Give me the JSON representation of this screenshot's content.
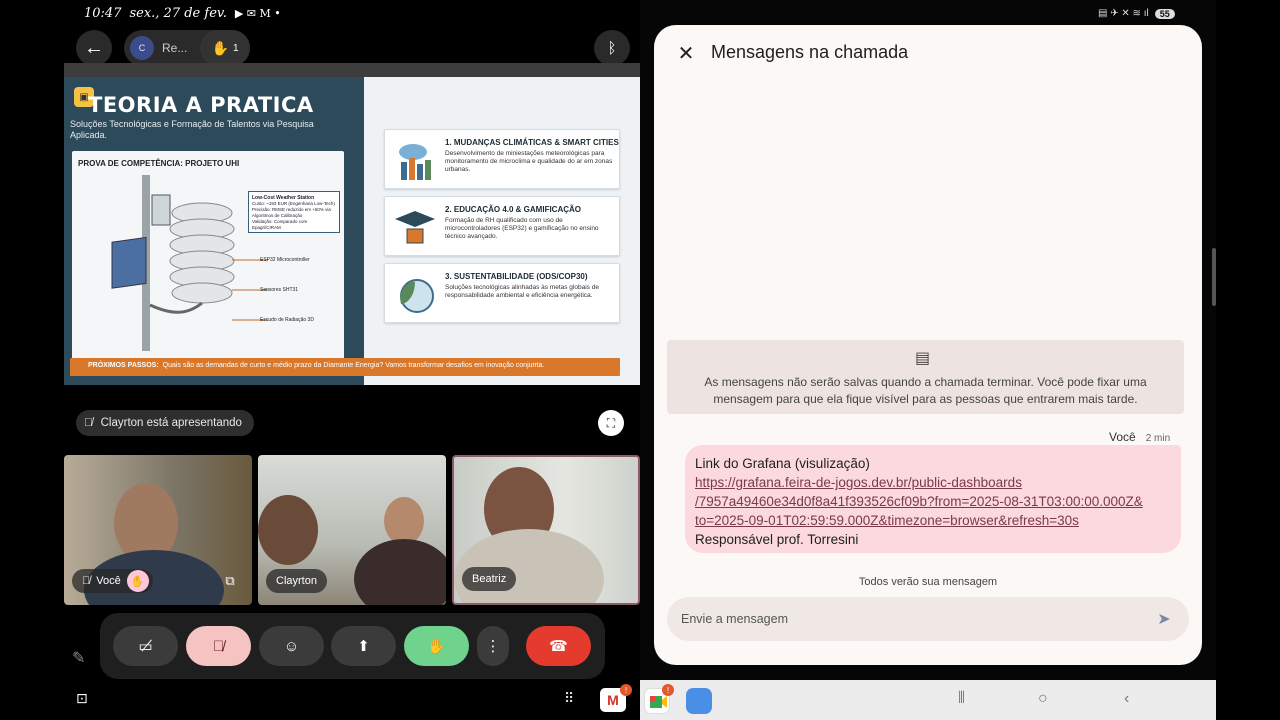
{
  "status_left": {
    "time": "10:47",
    "date": "sex., 27 de fev."
  },
  "topbar": {
    "participant_pill": "Re...",
    "hand_count": "1"
  },
  "slide": {
    "title": "TEORIA A PRATICA",
    "subtitle": "Soluções Tecnológicas e Formação de Talentos via Pesquisa Aplicada.",
    "proof_heading": "PROVA DE COMPETÊNCIA: PROJETO UHI",
    "callout_title": "Low-Cost Weather Station",
    "callout_lines": [
      "Custo: ~193 EUR (Engenharia Low-Tech)",
      "Precisão: RMSE reduzido em +50% via Algoritmos de Calibração",
      "Validação: Comparado com Epagri/CIRAM"
    ],
    "labels": [
      "ESP32 Microcontroller",
      "Sensores SHT31",
      "Escudo de Radiação 3D"
    ],
    "cards": [
      {
        "title": "1. MUDANÇAS CLIMÁTICAS & SMART CITIES",
        "desc": "Desenvolvimento de miniestações meteorológicas para monitoramento de microclima e qualidade do ar em zonas urbanas."
      },
      {
        "title": "2. EDUCAÇÃO 4.0 & GAMIFICAÇÃO",
        "desc": "Formação de RH qualificado com uso de microcontroladores (ESP32) e gamificação no ensino técnico avançado."
      },
      {
        "title": "3. SUSTENTABILIDADE (ODS/COP30)",
        "desc": "Soluções tecnológicas alinhadas às metas globais de responsabilidade ambiental e eficiência energética."
      }
    ],
    "next_label": "PRÓXIMOS PASSOS:",
    "next_text": "Quais são as demandas de curto e médio prazo da Diamante Energia? Vamos transformar desafios em inovação conjunta."
  },
  "presenting": "Clayrton está apresentando",
  "tiles": [
    {
      "name": "Você"
    },
    {
      "name": "Clayrton"
    },
    {
      "name": "Beatriz"
    }
  ],
  "chat": {
    "title": "Mensagens na chamada",
    "notice": "As mensagens não serão salvas quando a chamada terminar. Você pode fixar uma mensagem para que ela fique visível para as pessoas que entrarem mais tarde.",
    "sender": "Você",
    "time": "2 min",
    "message_line1": "Link do Grafana (visulização)",
    "link_1": "https://grafana.feira-de-jogos.dev.br/public-dashboards",
    "link_2": "/7957a49460e34d0f8a41f393526cf09b?from=2025-08-31T03:00:00.000Z&",
    "link_3": "to=2025-09-01T02:59:59.000Z&timezone=browser&refresh=30s",
    "message_line_last": "Responsável prof. Torresini",
    "everyone_sees": "Todos verão sua mensagem",
    "input_placeholder": "Envie a mensagem"
  },
  "status_right": {
    "battery": "55"
  },
  "badges": {
    "gmail": "!",
    "meet": "!"
  },
  "colors": {
    "hand_raised_green": "#6fd38d",
    "end_call_red": "#e53a2e",
    "mic_off_pink": "#f6c3c3",
    "bubble_pink": "#fbd9de"
  }
}
